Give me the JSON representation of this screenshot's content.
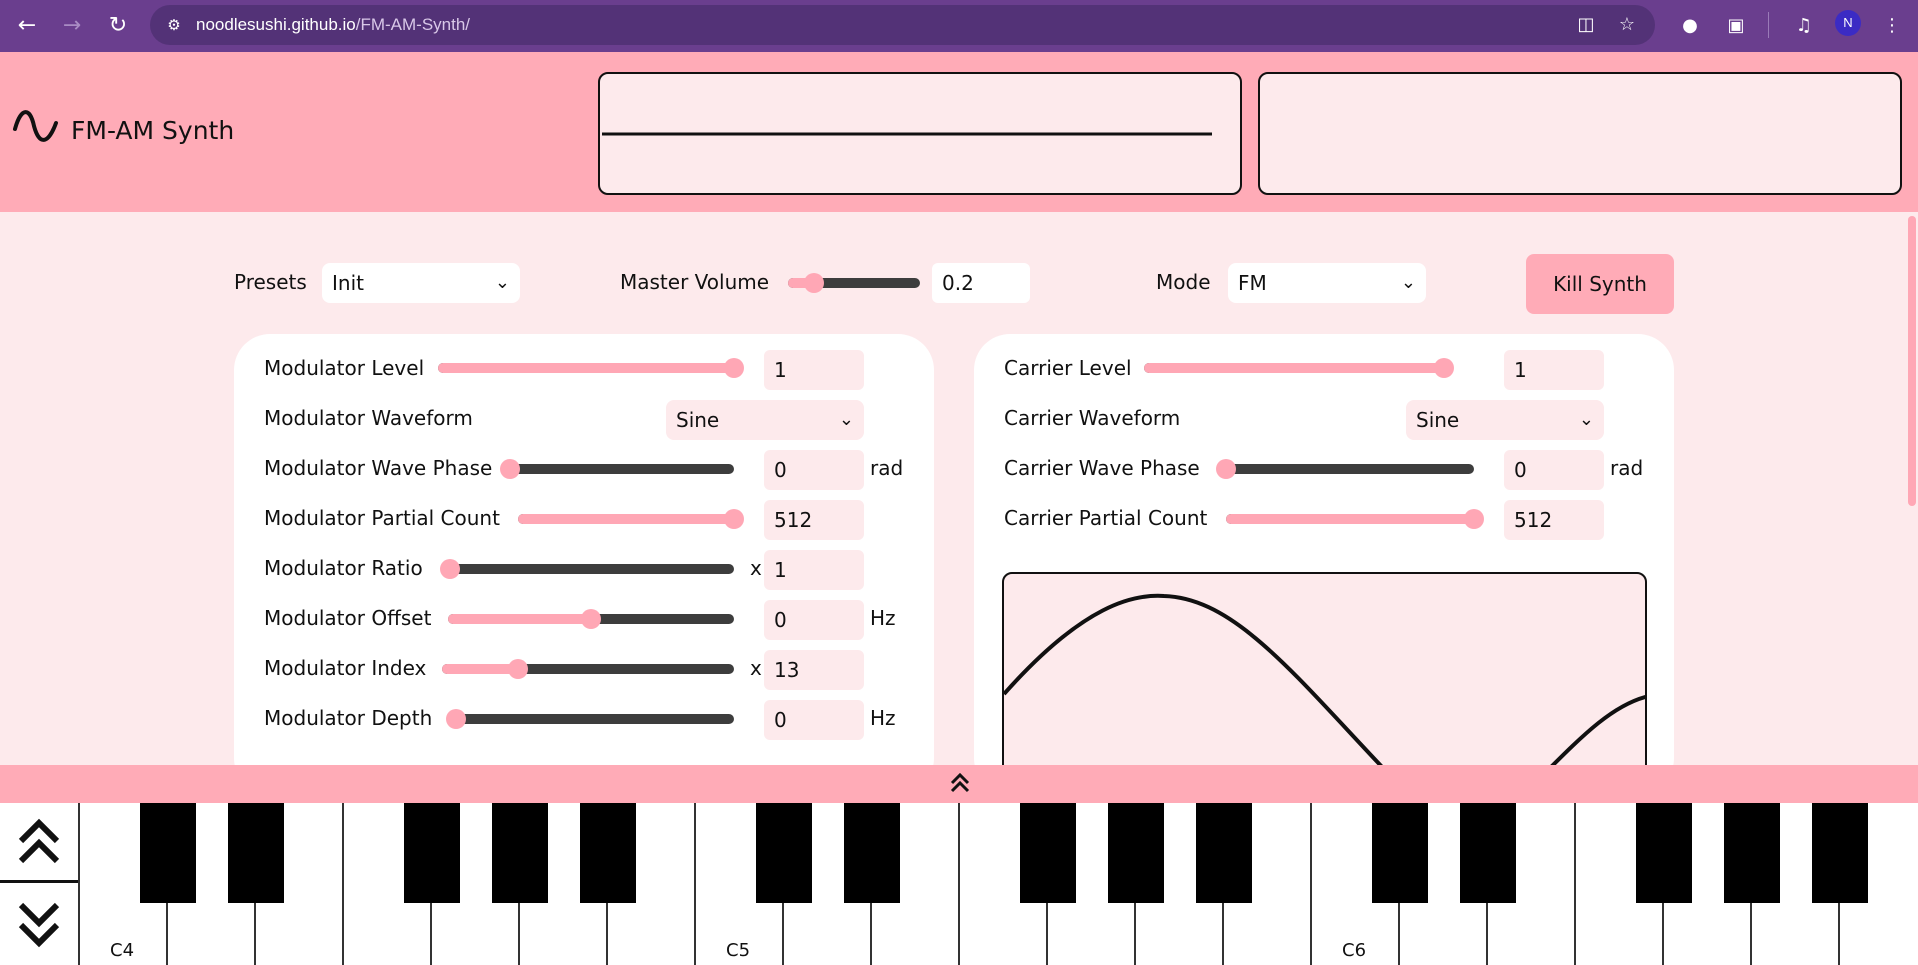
{
  "browser": {
    "url_domain": "noodlesushi.github.io",
    "url_path": "/FM-AM-Synth/",
    "profile_initial": "N",
    "icons": [
      "back-icon",
      "forward-icon",
      "reload-icon",
      "site-info-icon",
      "reading-mode-icon",
      "bookmark-star-icon",
      "extension-icon",
      "puzzle-icon",
      "media-icon",
      "profile-icon",
      "more-icon"
    ]
  },
  "app": {
    "title": "FM-AM Synth"
  },
  "controls": {
    "presets_label": "Presets",
    "presets_value": "Init",
    "master_volume_label": "Master Volume",
    "master_volume_value": "0.2",
    "master_volume_fraction": 0.2,
    "mode_label": "Mode",
    "mode_value": "FM",
    "kill_label": "Kill Synth"
  },
  "modulator": {
    "level_label": "Modulator Level",
    "level_value": "1",
    "waveform_label": "Modulator Waveform",
    "waveform_value": "Sine",
    "phase_label": "Modulator Wave Phase",
    "phase_value": "0",
    "phase_unit": "rad",
    "partials_label": "Modulator Partial Count",
    "partials_value": "512",
    "ratio_label": "Modulator Ratio",
    "ratio_prefix": "x",
    "ratio_value": "1",
    "offset_label": "Modulator Offset",
    "offset_value": "0",
    "offset_unit": "Hz",
    "index_label": "Modulator Index",
    "index_prefix": "x",
    "index_value": "13",
    "depth_label": "Modulator Depth",
    "depth_value": "0",
    "depth_unit": "Hz"
  },
  "carrier": {
    "level_label": "Carrier Level",
    "level_value": "1",
    "waveform_label": "Carrier Waveform",
    "waveform_value": "Sine",
    "phase_label": "Carrier Wave Phase",
    "phase_value": "0",
    "phase_unit": "rad",
    "partials_label": "Carrier Partial Count",
    "partials_value": "512"
  },
  "keyboard": {
    "labels": [
      "C4",
      "C5",
      "C6"
    ]
  },
  "colors": {
    "accent_pink": "#ffabb7",
    "background": "#fdeaec",
    "chrome_purple": "#6a3e8e"
  }
}
